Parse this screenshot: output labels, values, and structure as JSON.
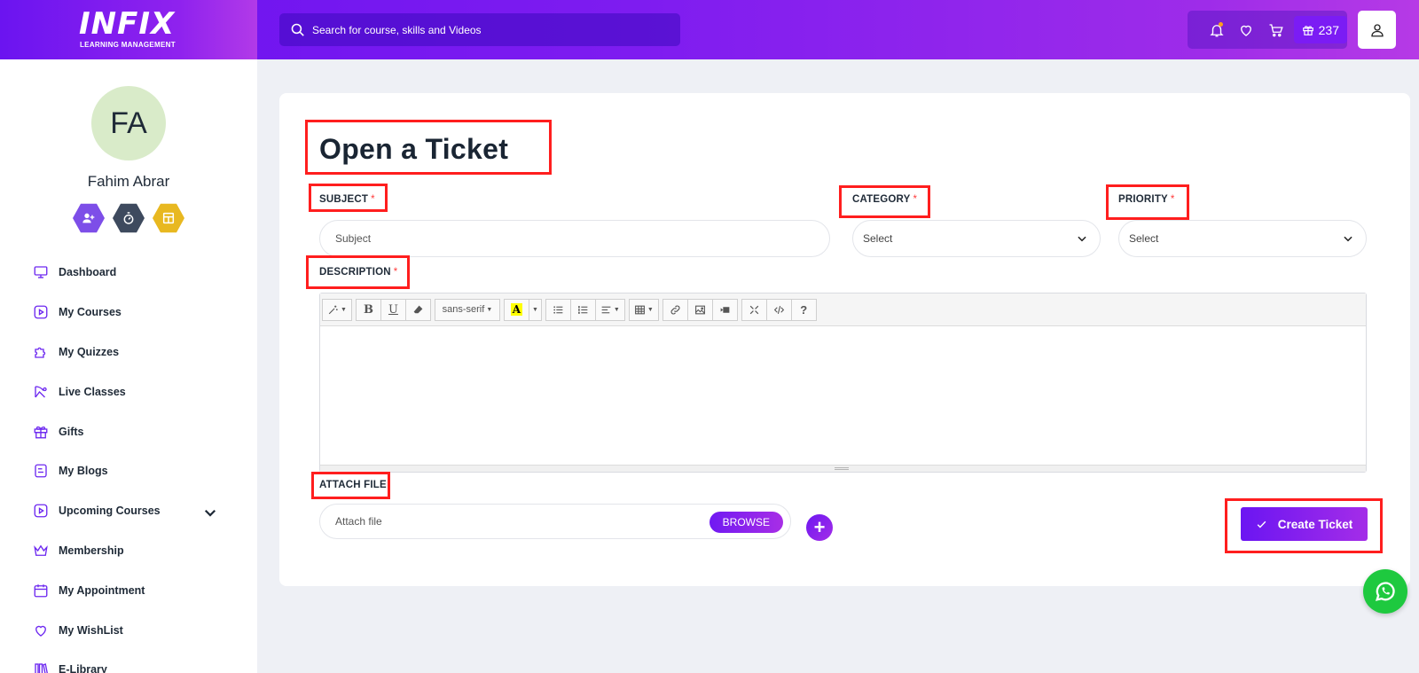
{
  "brand": {
    "logo": "INFIX",
    "tagline": "LEARNING MANAGEMENT"
  },
  "header": {
    "search_placeholder": "Search for course, skills and Videos",
    "gift_points": "237"
  },
  "user": {
    "initials": "FA",
    "name": "Fahim Abrar"
  },
  "sidebar": {
    "items": [
      {
        "label": "Dashboard",
        "icon": "monitor-icon"
      },
      {
        "label": "My Courses",
        "icon": "play-icon"
      },
      {
        "label": "My Quizzes",
        "icon": "puzzle-icon"
      },
      {
        "label": "Live Classes",
        "icon": "broadcast-icon"
      },
      {
        "label": "Gifts",
        "icon": "gift-icon"
      },
      {
        "label": "My Blogs",
        "icon": "blog-icon"
      },
      {
        "label": "Upcoming Courses",
        "icon": "play-icon"
      },
      {
        "label": "Membership",
        "icon": "crown-icon"
      },
      {
        "label": "My Appointment",
        "icon": "calendar-icon"
      },
      {
        "label": "My WishList",
        "icon": "heart-icon"
      },
      {
        "label": "E-Library",
        "icon": "library-icon"
      }
    ]
  },
  "form": {
    "title": "Open a Ticket",
    "subject_label": "SUBJECT",
    "subject_placeholder": "Subject",
    "category_label": "CATEGORY",
    "category_value": "Select",
    "priority_label": "PRIORITY",
    "priority_value": "Select",
    "description_label": "DESCRIPTION",
    "required_mark": "*",
    "attach_label": "ATTACH FILE",
    "attach_placeholder": "Attach file",
    "browse_label": "BROWSE",
    "plus_label": "+",
    "submit_label": "Create Ticket"
  },
  "editor": {
    "font_name": "sans-serif",
    "bold": "B",
    "underline": "U",
    "color_letter": "A"
  },
  "colors": {
    "brand_purple": "#7019f2",
    "annotation_red": "#ff1e1e",
    "whatsapp_green": "#1ec93f"
  }
}
